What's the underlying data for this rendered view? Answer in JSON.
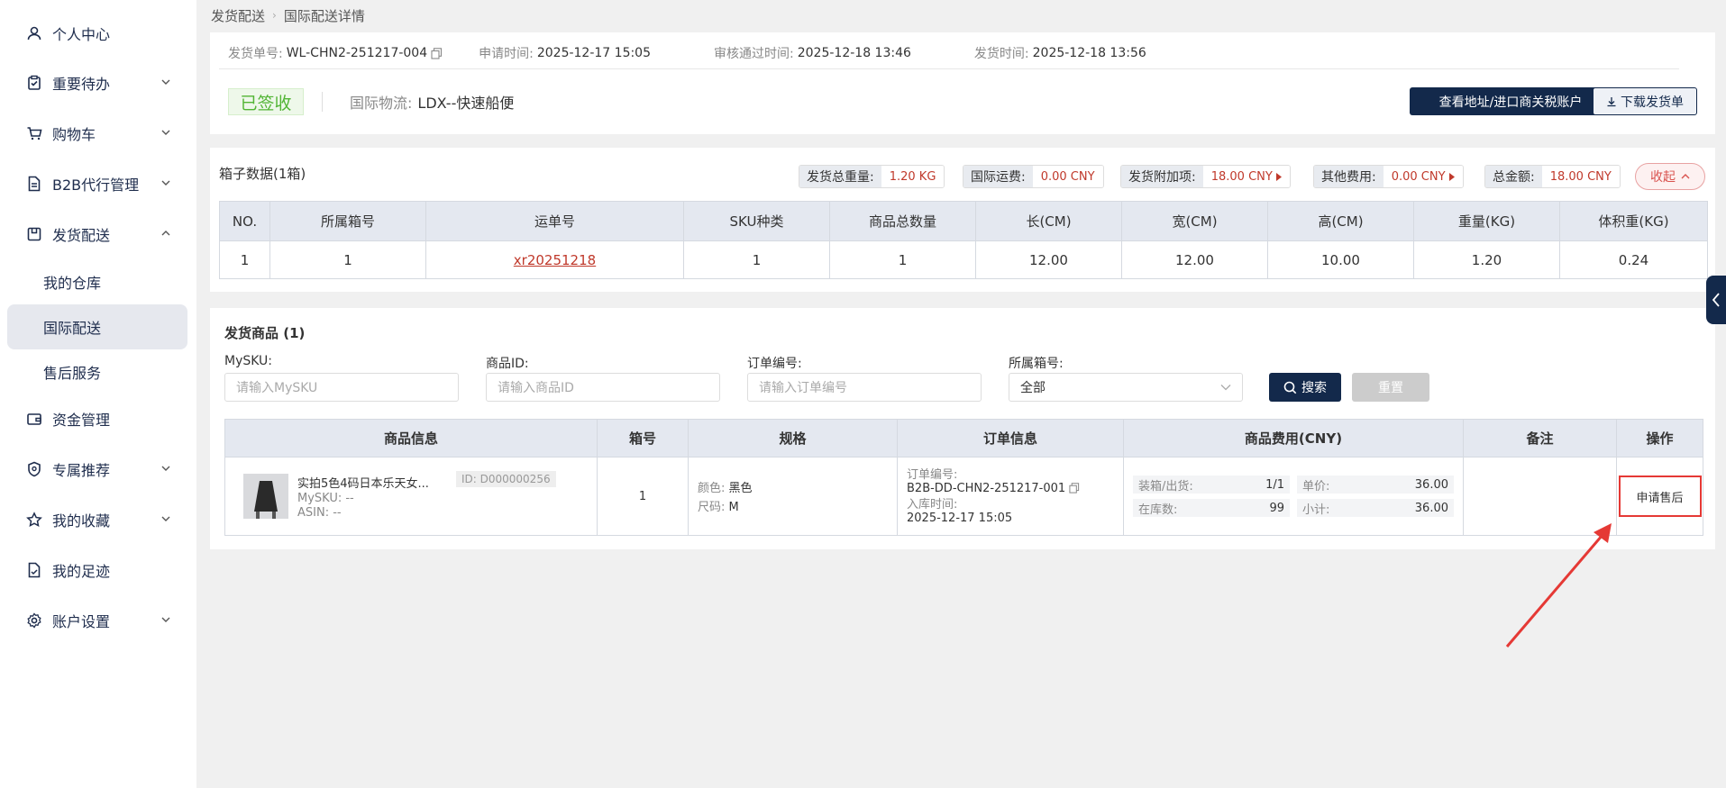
{
  "sidebar": {
    "items": [
      {
        "label": "个人中心",
        "icon": "user-icon"
      },
      {
        "label": "重要待办",
        "icon": "clipboard-check-icon"
      },
      {
        "label": "购物车",
        "icon": "cart-icon"
      },
      {
        "label": "B2B代行管理",
        "icon": "document-icon"
      },
      {
        "label": "发货配送",
        "icon": "box-icon"
      },
      {
        "label": "资金管理",
        "icon": "wallet-icon"
      },
      {
        "label": "专属推荐",
        "icon": "badge-icon"
      },
      {
        "label": "我的收藏",
        "icon": "star-icon"
      },
      {
        "label": "我的足迹",
        "icon": "footprint-icon"
      },
      {
        "label": "账户设置",
        "icon": "gear-icon"
      }
    ],
    "sub_items": [
      "我的仓库",
      "国际配送",
      "售后服务"
    ]
  },
  "breadcrumb": {
    "parent": "发货配送",
    "current": "国际配送详情"
  },
  "header": {
    "shipment_no_label": "发货单号:",
    "shipment_no": "WL-CHN2-251217-004",
    "apply_time_label": "申请时间:",
    "apply_time": "2025-12-17 15:05",
    "approve_time_label": "审核通过时间:",
    "approve_time": "2025-12-18 13:46",
    "ship_time_label": "发货时间:",
    "ship_time": "2025-12-18 13:56",
    "status": "已签收",
    "logistics_label": "国际物流:",
    "logistics": "LDX--快速船便",
    "view_address_btn": "查看地址/进口商关税账户",
    "download_btn": "下载发货单"
  },
  "box_data": {
    "title": "箱子数据(1箱)",
    "total_weight_label": "发货总重量:",
    "total_weight": "1.20 KG",
    "intl_freight_label": "国际运费:",
    "intl_freight": "0.00 CNY",
    "surcharge_label": "发货附加项:",
    "surcharge": "18.00 CNY",
    "other_fee_label": "其他费用:",
    "other_fee": "0.00 CNY",
    "total_label": "总金额:",
    "total": "18.00 CNY",
    "collapse_btn": "收起",
    "columns": [
      "NO.",
      "所属箱号",
      "运单号",
      "SKU种类",
      "商品总数量",
      "长(CM)",
      "宽(CM)",
      "高(CM)",
      "重量(KG)",
      "体积重(KG)"
    ],
    "rows": [
      [
        "1",
        "1",
        "xr20251218",
        "1",
        "1",
        "12.00",
        "12.00",
        "10.00",
        "1.20",
        "0.24"
      ]
    ]
  },
  "goods": {
    "title": "发货商品 (1)",
    "filters": {
      "mysku_label": "MySKU:",
      "mysku_placeholder": "请输入MySKU",
      "product_id_label": "商品ID:",
      "product_id_placeholder": "请输入商品ID",
      "order_no_label": "订单编号:",
      "order_no_placeholder": "请输入订单编号",
      "box_no_label": "所属箱号:",
      "box_no_value": "全部"
    },
    "search_btn": "搜索",
    "reset_btn": "重置",
    "columns": [
      "商品信息",
      "箱号",
      "规格",
      "订单信息",
      "商品费用(CNY)",
      "备注",
      "操作"
    ],
    "row": {
      "name": "实拍5色4码日本乐天女...",
      "id_tag": "ID: D000000256",
      "mysku": "MySKU: --",
      "asin": "ASIN: --",
      "box_no": "1",
      "color_label": "颜色:",
      "color": "黑色",
      "size_label": "尺码:",
      "size": "M",
      "order_no_label": "订单编号:",
      "order_no": "B2B-DD-CHN2-251217-001",
      "inbound_label": "入库时间:",
      "inbound_time": "2025-12-17 15:05",
      "packing_label": "装箱/出货:",
      "packing": "1/1",
      "unit_price_label": "单价:",
      "unit_price": "36.00",
      "stock_label": "在库数:",
      "stock": "99",
      "subtotal_label": "小计:",
      "subtotal": "36.00",
      "action": "申请售后"
    }
  },
  "colors": {
    "primary": "#13294b",
    "accent_red": "#e53935",
    "success": "#52b535"
  }
}
